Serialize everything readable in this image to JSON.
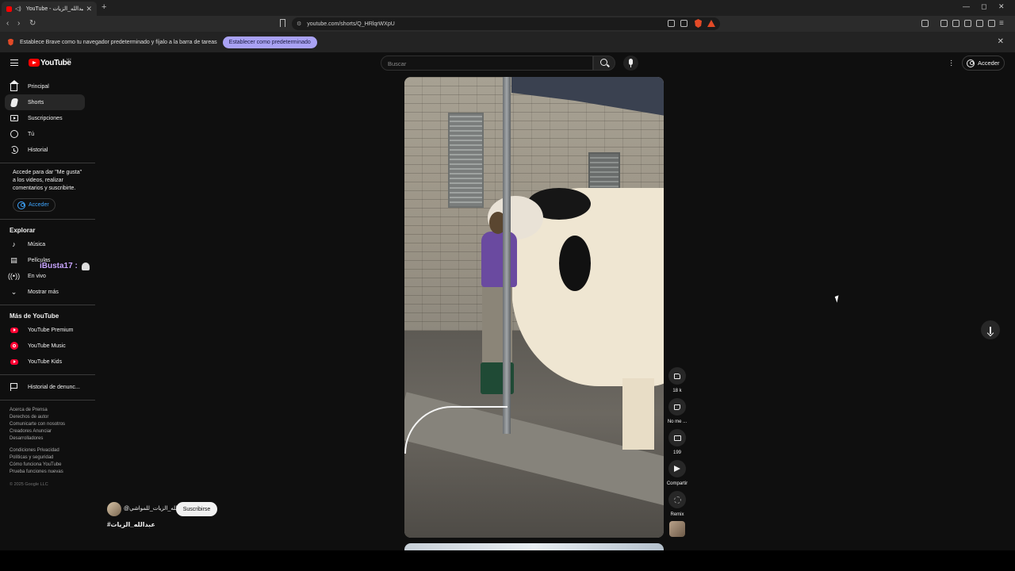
{
  "browser": {
    "tab_title": "YouTube - عبدالله_الزيات#",
    "new_tab_icon": "plus",
    "url": "youtube.com/shorts/Q_HRlqrWXpU",
    "window_controls": [
      "minimize",
      "maximize",
      "close"
    ]
  },
  "infobar": {
    "message": "Establece Brave como tu navegador predeterminado y fíjalo a la barra de tareas",
    "button_label": "Establecer como predeterminado"
  },
  "header": {
    "logo_text": "YouTube",
    "logo_country": "MX",
    "search_placeholder": "Buscar",
    "signin_label": "Acceder"
  },
  "sidebar": {
    "main_items": [
      {
        "label": "Principal",
        "icon": "home-icon"
      },
      {
        "label": "Shorts",
        "icon": "shorts-icon",
        "active": true
      },
      {
        "label": "Suscripciones",
        "icon": "subscriptions-icon"
      },
      {
        "label": "Tú",
        "icon": "you-icon"
      },
      {
        "label": "Historial",
        "icon": "history-icon"
      }
    ],
    "signin_prompt": "Accede para dar \"Me gusta\" a los videos, realizar comentarios y suscribirte.",
    "signin_button": "Acceder",
    "explore_heading": "Explorar",
    "explore_items": [
      {
        "label": "Música",
        "icon": "music-icon"
      },
      {
        "label": "Películas",
        "icon": "movies-icon"
      },
      {
        "label": "En vivo",
        "icon": "live-icon"
      },
      {
        "label": "Mostrar más",
        "icon": "chevron-down-icon"
      }
    ],
    "more_heading": "Más de YouTube",
    "more_items": [
      {
        "label": "YouTube Premium",
        "icon": "youtube-premium-icon"
      },
      {
        "label": "YouTube Music",
        "icon": "youtube-music-icon"
      },
      {
        "label": "YouTube Kids",
        "icon": "youtube-kids-icon"
      }
    ],
    "report_history": "Historial de denunc...",
    "footer_links_1": "Acerca de  Prensa\nDerechos de autor\nComunicarte con nosotros\nCreadores  Anunciar\nDesarrolladores",
    "footer_links_2": "Condiciones  Privacidad\nPolíticas y seguridad\nCómo funciona YouTube\nPrueba funciones nuevas",
    "copyright": "© 2025 Google LLC"
  },
  "overlay": {
    "tag": "iBusta17 :"
  },
  "short": {
    "channel_name": "@عبدالله_الزيات_للمواشي",
    "subscribe_label": "Suscribirse",
    "hashtag": "#عبدالله_الزيات",
    "actions": {
      "likes": "18 k",
      "dislike_label": "No me ...",
      "comments": "199",
      "share_label": "Compartir",
      "remix_label": "Remix"
    }
  },
  "colors": {
    "background": "#0f0f0f",
    "accent_blue": "#3ea6ff",
    "youtube_red": "#ff0000",
    "brave_button": "#a9a2f4"
  }
}
